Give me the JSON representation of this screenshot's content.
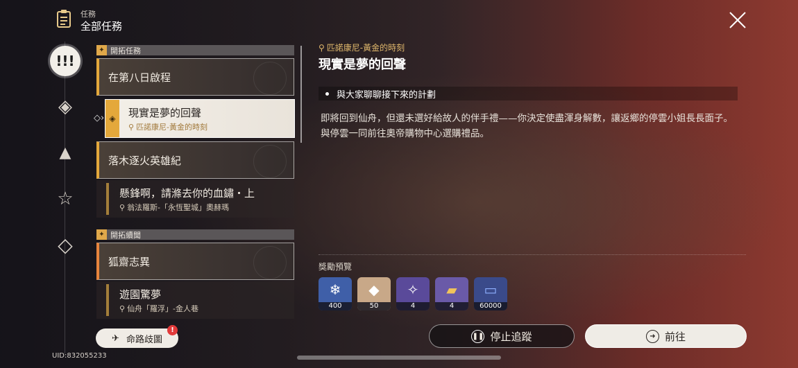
{
  "header": {
    "section_small": "任務",
    "title": "全部任務"
  },
  "sidebar": {
    "items": [
      {
        "icon": "exclamation-icon",
        "glyph": "!!!",
        "active": true
      },
      {
        "icon": "trailblaze-diamond-icon",
        "glyph": "◈"
      },
      {
        "icon": "triangle-icon",
        "glyph": "▲"
      },
      {
        "icon": "star-icon",
        "glyph": "☆"
      },
      {
        "icon": "diamond-icon",
        "glyph": "◇"
      }
    ]
  },
  "list": {
    "sections": [
      {
        "label": "開拓任務"
      },
      {
        "label": "開拓續聞"
      }
    ],
    "quests": [
      {
        "title": "在第八日啟程"
      },
      {
        "title": "現實是夢的回聲",
        "location": "匹諾康尼-黃金的時刻"
      },
      {
        "title": "落木逐火英雄紀"
      },
      {
        "title": "懸鋒啊，請滌去你的血鏽・上",
        "location": "翁法羅斯-「永恆聖城」奧赫瑪"
      },
      {
        "title": "狐齋志異"
      },
      {
        "title": "遊園驚夢",
        "location": "仙舟「羅浮」-金人巷"
      }
    ]
  },
  "detail": {
    "location": "匹諾康尼-黃金的時刻",
    "title": "現實是夢的回聲",
    "objective": "與大家聊聊接下來的計劃",
    "description": [
      "即將回到仙舟，但還未選好給故人的伴手禮——你決定使盡渾身解數，讓返鄉的停雲小姐長長面子。",
      "與停雲一同前往奧帝購物中心選購禮品。"
    ]
  },
  "rewards": {
    "label": "獎勵預覽",
    "items": [
      {
        "icon": "credit-crystal-icon",
        "count": "400",
        "color": "#3f5fa8"
      },
      {
        "icon": "stellar-jade-icon",
        "count": "50",
        "color": "#c8a888"
      },
      {
        "icon": "material-purple-icon",
        "count": "4",
        "color": "#5a4a9a"
      },
      {
        "icon": "book-gold-icon",
        "count": "4",
        "color": "#6a5aa8"
      },
      {
        "icon": "credit-card-icon",
        "count": "60000",
        "color": "#3a4a8a"
      }
    ]
  },
  "buttons": {
    "stop_tracking": "停止追蹤",
    "go": "前往",
    "destiny_map": "命路歧圖",
    "alert": "!"
  },
  "footer": {
    "uid": "UID:832055233"
  }
}
